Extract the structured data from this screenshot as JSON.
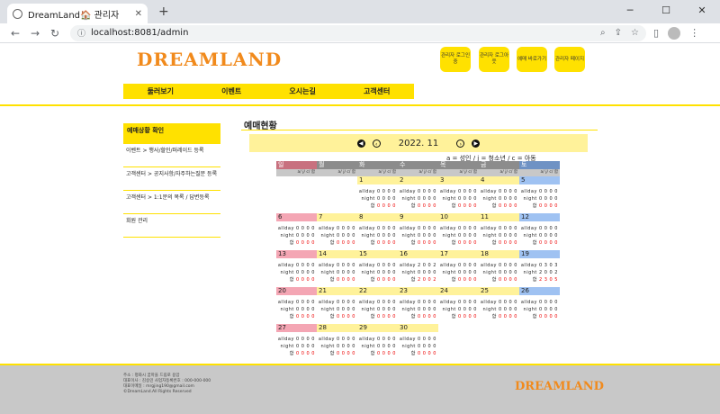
{
  "browser": {
    "tab_title": "DreamLand🏠 관리자",
    "url": "localhost:8081/admin",
    "new_tab": "+",
    "close": "✕"
  },
  "header": {
    "logo": "DREAMLAND",
    "admin_buttons": [
      "관리자 로그인중",
      "관리자 로그아웃",
      "예매 바로가기",
      "관리자 페이지"
    ],
    "menu": [
      "둘러보기",
      "이벤트",
      "오시는길",
      "고객센터"
    ]
  },
  "sidebar": {
    "caption": "예매상황 확인",
    "items": [
      "이벤트 > 행사/할인/퍼레이드 등록",
      "고객센터 > 공지사항/자주하는질문 등록",
      "고객센터 > 1:1문의 목록 / 답변등록",
      "회원 관리"
    ]
  },
  "main": {
    "title": "예매현황",
    "month": "2022. 11",
    "legend": "a = 성인 / j = 청소년 / c = 아동",
    "weekdays": [
      "일",
      "월",
      "화",
      "수",
      "목",
      "금",
      "토"
    ],
    "subhead": "a/ j/ c/ 합",
    "row_labels": {
      "allday": "allday",
      "night": "night",
      "sum": "합"
    }
  },
  "calendar": [
    {
      "day": "",
      "allday": "",
      "night": "",
      "sum": ""
    },
    {
      "day": "",
      "allday": "",
      "night": "",
      "sum": ""
    },
    {
      "day": "1",
      "allday": "0 0 0 0",
      "night": "0 0 0 0",
      "sum": "0 0 0 0"
    },
    {
      "day": "2",
      "allday": "0 0 0 0",
      "night": "0 0 0 0",
      "sum": "0 0 0 0"
    },
    {
      "day": "3",
      "allday": "0 0 0 0",
      "night": "0 0 0 0",
      "sum": "0 0 0 0"
    },
    {
      "day": "4",
      "allday": "0 0 0 0",
      "night": "0 0 0 0",
      "sum": "0 0 0 0"
    },
    {
      "day": "5",
      "allday": "0 0 0 0",
      "night": "0 0 0 0",
      "sum": "0 0 0 0"
    },
    {
      "day": "6",
      "allday": "0 0 0 0",
      "night": "0 0 0 0",
      "sum": "0 0 0 0"
    },
    {
      "day": "7",
      "allday": "0 0 0 0",
      "night": "0 0 0 0",
      "sum": "0 0 0 0"
    },
    {
      "day": "8",
      "allday": "0 0 0 0",
      "night": "0 0 0 0",
      "sum": "0 0 0 0"
    },
    {
      "day": "9",
      "allday": "0 0 0 0",
      "night": "0 0 0 0",
      "sum": "0 0 0 0"
    },
    {
      "day": "10",
      "allday": "0 0 0 0",
      "night": "0 0 0 0",
      "sum": "0 0 0 0"
    },
    {
      "day": "11",
      "allday": "0 0 0 0",
      "night": "0 0 0 0",
      "sum": "0 0 0 0"
    },
    {
      "day": "12",
      "allday": "0 0 0 0",
      "night": "0 0 0 0",
      "sum": "0 0 0 0"
    },
    {
      "day": "13",
      "allday": "0 0 0 0",
      "night": "0 0 0 0",
      "sum": "0 0 0 0"
    },
    {
      "day": "14",
      "allday": "0 0 0 0",
      "night": "0 0 0 0",
      "sum": "0 0 0 0"
    },
    {
      "day": "15",
      "allday": "0 0 0 0",
      "night": "0 0 0 0",
      "sum": "0 0 0 0"
    },
    {
      "day": "16",
      "allday": "2 0 0 2",
      "night": "0 0 0 0",
      "sum": "2 0 0 2"
    },
    {
      "day": "17",
      "allday": "0 0 0 0",
      "night": "0 0 0 0",
      "sum": "0 0 0 0"
    },
    {
      "day": "18",
      "allday": "0 0 0 0",
      "night": "0 0 0 0",
      "sum": "0 0 0 0"
    },
    {
      "day": "19",
      "allday": "0 3 0 3",
      "night": "2 0 0 2",
      "sum": "2 3 0 5"
    },
    {
      "day": "20",
      "allday": "0 0 0 0",
      "night": "0 0 0 0",
      "sum": "0 0 0 0"
    },
    {
      "day": "21",
      "allday": "0 0 0 0",
      "night": "0 0 0 0",
      "sum": "0 0 0 0"
    },
    {
      "day": "22",
      "allday": "0 0 0 0",
      "night": "0 0 0 0",
      "sum": "0 0 0 0"
    },
    {
      "day": "23",
      "allday": "0 0 0 0",
      "night": "0 0 0 0",
      "sum": "0 0 0 0"
    },
    {
      "day": "24",
      "allday": "0 0 0 0",
      "night": "0 0 0 0",
      "sum": "0 0 0 0"
    },
    {
      "day": "25",
      "allday": "0 0 0 0",
      "night": "0 0 0 0",
      "sum": "0 0 0 0"
    },
    {
      "day": "26",
      "allday": "0 0 0 0",
      "night": "0 0 0 0",
      "sum": "0 0 0 0"
    },
    {
      "day": "27",
      "allday": "0 0 0 0",
      "night": "0 0 0 0",
      "sum": "0 0 0 0"
    },
    {
      "day": "28",
      "allday": "0 0 0 0",
      "night": "0 0 0 0",
      "sum": "0 0 0 0"
    },
    {
      "day": "29",
      "allday": "0 0 0 0",
      "night": "0 0 0 0",
      "sum": "0 0 0 0"
    },
    {
      "day": "30",
      "allday": "0 0 0 0",
      "night": "0 0 0 0",
      "sum": "0 0 0 0"
    }
  ],
  "footer": {
    "lines": [
      "주소 : 평화시 꿈마을 드림로 용암",
      "대표이사 : 김승민  사업자등록번호 : 000-000-000",
      "대표이메일 : mrgjing190@gmail.com",
      "©DreamLand.All Rights Reserved"
    ],
    "logo": "DREAMLAND"
  },
  "colors": {
    "accent": "#ffe100",
    "logo": "#f18a1c",
    "sunday": "#f4a6b4",
    "saturday": "#9fc2f2",
    "weekday": "#fff29a",
    "head_sun": "#c8717f",
    "head_sat": "#6f92c4",
    "head_other": "#8c8c8c"
  }
}
